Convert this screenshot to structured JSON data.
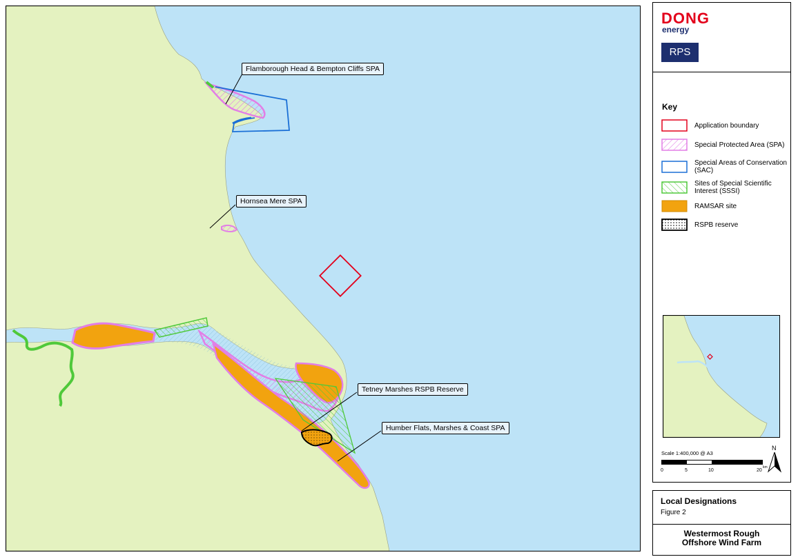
{
  "map": {
    "callouts": [
      "Flamborough Head & Bempton Cliffs SPA",
      "Hornsea Mere SPA",
      "Tetney Marshes RSPB Reserve",
      "Humber Flats, Marshes & Coast SPA"
    ]
  },
  "logos": {
    "brand": "DONG",
    "brand_sub": "energy",
    "consultant": "RPS"
  },
  "key": {
    "title": "Key",
    "items": [
      {
        "name": "application-boundary",
        "label": "Application boundary",
        "color": "#e3001b"
      },
      {
        "name": "spa",
        "label": "Special Protected Area (SPA)",
        "color": "#e27ee6"
      },
      {
        "name": "sac",
        "label": "Special Areas of Conservation (SAC)",
        "color": "#1a6fd6"
      },
      {
        "name": "sssi",
        "label": "Sites of Special Scientific Interest (SSSI)",
        "color": "#4fc93a"
      },
      {
        "name": "ramsar",
        "label": "RAMSAR site",
        "color": "#f2a30f"
      },
      {
        "name": "rspb",
        "label": "RSPB reserve",
        "color": "#000000"
      }
    ]
  },
  "scale": {
    "text": "Scale 1:400,000 @ A3",
    "ticks": [
      "0",
      "5",
      "10",
      "20"
    ],
    "unit": "km"
  },
  "north_label": "N",
  "figure": {
    "title": "Local Designations",
    "number": "Figure 2"
  },
  "project": {
    "line1": "Westermost Rough",
    "line2": "Offshore Wind Farm"
  },
  "colors": {
    "sea": "#bde3f7",
    "land": "#e4f2c0"
  }
}
